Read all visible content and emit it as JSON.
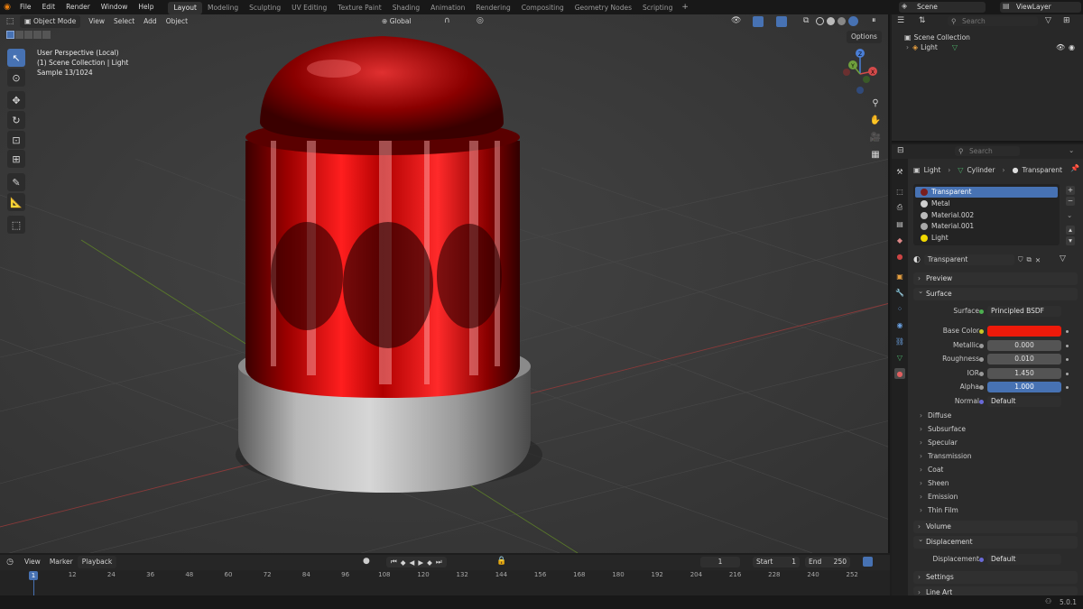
{
  "topbar": {
    "menus": [
      "File",
      "Edit",
      "Render",
      "Window",
      "Help"
    ],
    "workspaces": [
      "Layout",
      "Modeling",
      "Sculpting",
      "UV Editing",
      "Texture Paint",
      "Shading",
      "Animation",
      "Rendering",
      "Compositing",
      "Geometry Nodes",
      "Scripting"
    ],
    "active_workspace": "Layout",
    "scene": "Scene",
    "view_layer": "ViewLayer"
  },
  "viewport": {
    "mode": "Object Mode",
    "menus": [
      "View",
      "Select",
      "Add",
      "Object"
    ],
    "transform_orientation": "Global",
    "options_label": "Options",
    "hud": {
      "line1": "User Perspective (Local)",
      "line2": "(1) Scene Collection | Light",
      "line3": "Sample 13/1024"
    },
    "gizmo": {
      "z": "Z",
      "x": "X",
      "y": "Y"
    },
    "tools": [
      "select-box-icon",
      "cursor-icon",
      "move-icon",
      "rotate-icon",
      "scale-icon",
      "transform-icon",
      "annotate-icon",
      "measure-icon",
      "add-cube-icon"
    ]
  },
  "outliner": {
    "search_placeholder": "Search",
    "root": "Scene Collection",
    "items": [
      {
        "label": "Light"
      }
    ]
  },
  "properties": {
    "search_placeholder": "Search",
    "breadcrumb": [
      "Light",
      "Cylinder",
      "Transparent"
    ],
    "material_slots": [
      {
        "label": "Transparent",
        "color": "#7a1e1e",
        "selected": true
      },
      {
        "label": "Metal",
        "color": "#cfcfcf",
        "selected": false
      },
      {
        "label": "Material.002",
        "color": "#bbbbbb",
        "selected": false
      },
      {
        "label": "Material.001",
        "color": "#a8a8a8",
        "selected": false
      },
      {
        "label": "Light",
        "color": "#f0d800",
        "selected": false
      }
    ],
    "material_name": "Transparent",
    "panels": {
      "preview": "Preview",
      "surface": "Surface",
      "volume": "Volume",
      "displacement": "Displacement",
      "settings": "Settings",
      "line_art": "Line Art"
    },
    "surface": {
      "surface_label": "Surface",
      "surface_value": "Principled BSDF",
      "base_color_label": "Base Color",
      "base_color": "#ee1a0a",
      "metallic_label": "Metallic",
      "metallic": "0.000",
      "roughness_label": "Roughness",
      "roughness": "0.010",
      "ior_label": "IOR",
      "ior": "1.450",
      "alpha_label": "Alpha",
      "alpha": "1.000",
      "normal_label": "Normal",
      "normal": "Default"
    },
    "subpanels": [
      "Diffuse",
      "Subsurface",
      "Specular",
      "Transmission",
      "Coat",
      "Sheen",
      "Emission",
      "Thin Film"
    ],
    "displacement": {
      "label": "Displacement",
      "value": "Default"
    }
  },
  "timeline": {
    "menus": [
      "View",
      "Marker",
      "Playback"
    ],
    "current_frame": "1",
    "start_label": "Start",
    "start": "1",
    "end_label": "End",
    "end": "250",
    "frames": [
      "1",
      "12",
      "24",
      "36",
      "48",
      "60",
      "72",
      "84",
      "96",
      "108",
      "120",
      "132",
      "144",
      "156",
      "168",
      "180",
      "192",
      "204",
      "216",
      "228",
      "240",
      "252"
    ]
  },
  "statusbar": {
    "version": "5.0.1"
  },
  "colors": {
    "accent": "#4772b3",
    "active_tab": "#4772b3"
  }
}
